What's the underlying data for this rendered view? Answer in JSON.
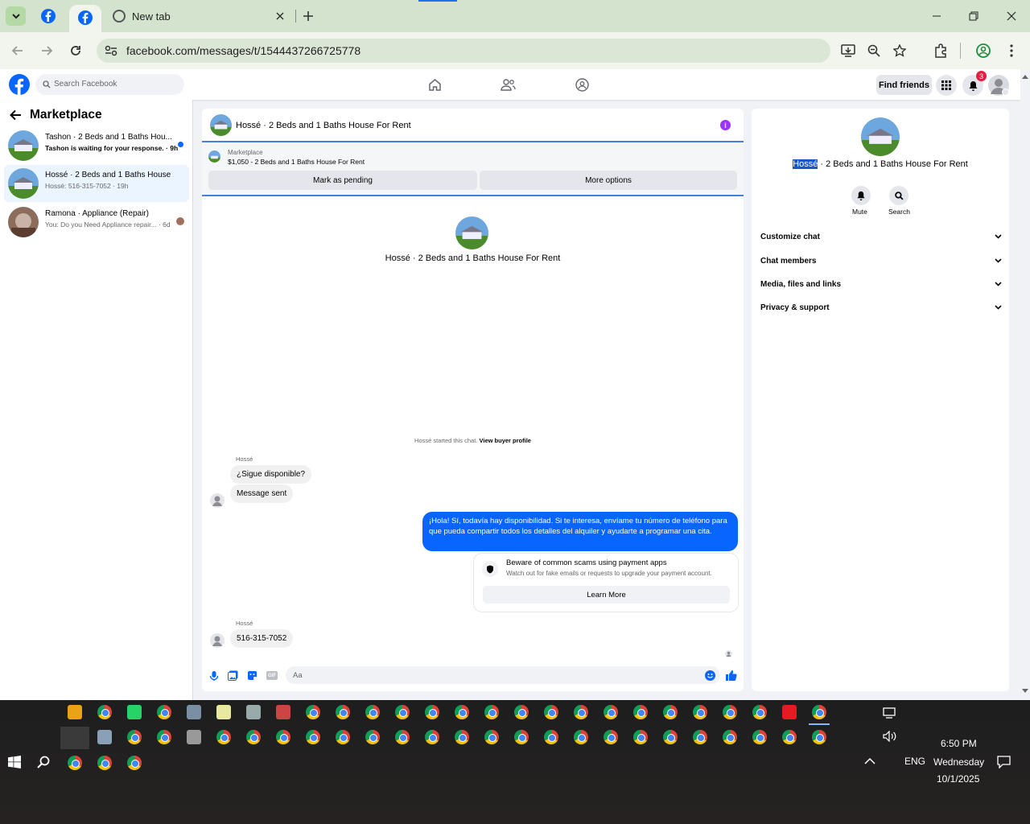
{
  "browser": {
    "tabs": [
      {
        "title": "",
        "icon": "facebook-icon"
      },
      {
        "title": "",
        "icon": "facebook-icon",
        "active": true
      },
      {
        "title": "New tab",
        "icon": "chrome-icon"
      }
    ],
    "url": "facebook.com/messages/t/1544437266725778"
  },
  "fb": {
    "search_placeholder": "Search Facebook",
    "find_friends": "Find friends",
    "notification_count": "3",
    "brand_color": "#0866ff"
  },
  "sidebar": {
    "title": "Marketplace",
    "conversations": [
      {
        "name": "Tashon · 2 Beds and 1 Baths Hou...",
        "preview": "Tashon is waiting for your response. · 9h",
        "unread": true
      },
      {
        "name": "Hossé · 2 Beds and 1 Baths House ...",
        "preview": "Hossé: 516-315-7052 · 19h",
        "selected": true
      },
      {
        "name": "Ramona · Appliance (Repair)",
        "preview": "You: Do you Need Appliance repair... · 6d"
      }
    ]
  },
  "chat": {
    "header_title": "Hossé · 2 Beds and 1 Baths House For Rent",
    "listing": {
      "label": "Marketplace",
      "price_title": "$1,050 - 2 Beds and 1 Baths House For Rent"
    },
    "mark_pending": "Mark as pending",
    "more_options": "More options",
    "intro_title": "Hossé · 2 Beds and 1 Baths House For Rent",
    "started_text": "Hossé started this chat.",
    "view_buyer_profile": "View buyer profile",
    "sender1": "Hossé",
    "msg1": "¿Sigue disponible?",
    "msg2": "Message sent",
    "outgoing": "¡Hola! Sí, todavía hay disponibilidad. Si te interesa, envíame tu número de teléfono para que pueda compartir todos los detalles del alquiler y ayudarte a programar una cita.",
    "scam_title": "Beware of common scams using payment apps",
    "scam_sub": "Watch out for fake emails or requests to upgrade your payment account.",
    "learn_more": "Learn More",
    "sender2": "Hossé",
    "msg3": "516-315-7052",
    "composer_placeholder": "Aa",
    "bubble_color": "#0866ff"
  },
  "info": {
    "name_highlight": "Hossé",
    "name_rest": " · 2 Beds and 1 Baths House For Rent",
    "mute": "Mute",
    "search": "Search",
    "sections": [
      "Customize chat",
      "Chat members",
      "Media, files and links",
      "Privacy & support"
    ]
  },
  "taskbar": {
    "time": "6:50 PM",
    "day": "Wednesday",
    "date": "10/1/2025",
    "lang": "ENG"
  }
}
